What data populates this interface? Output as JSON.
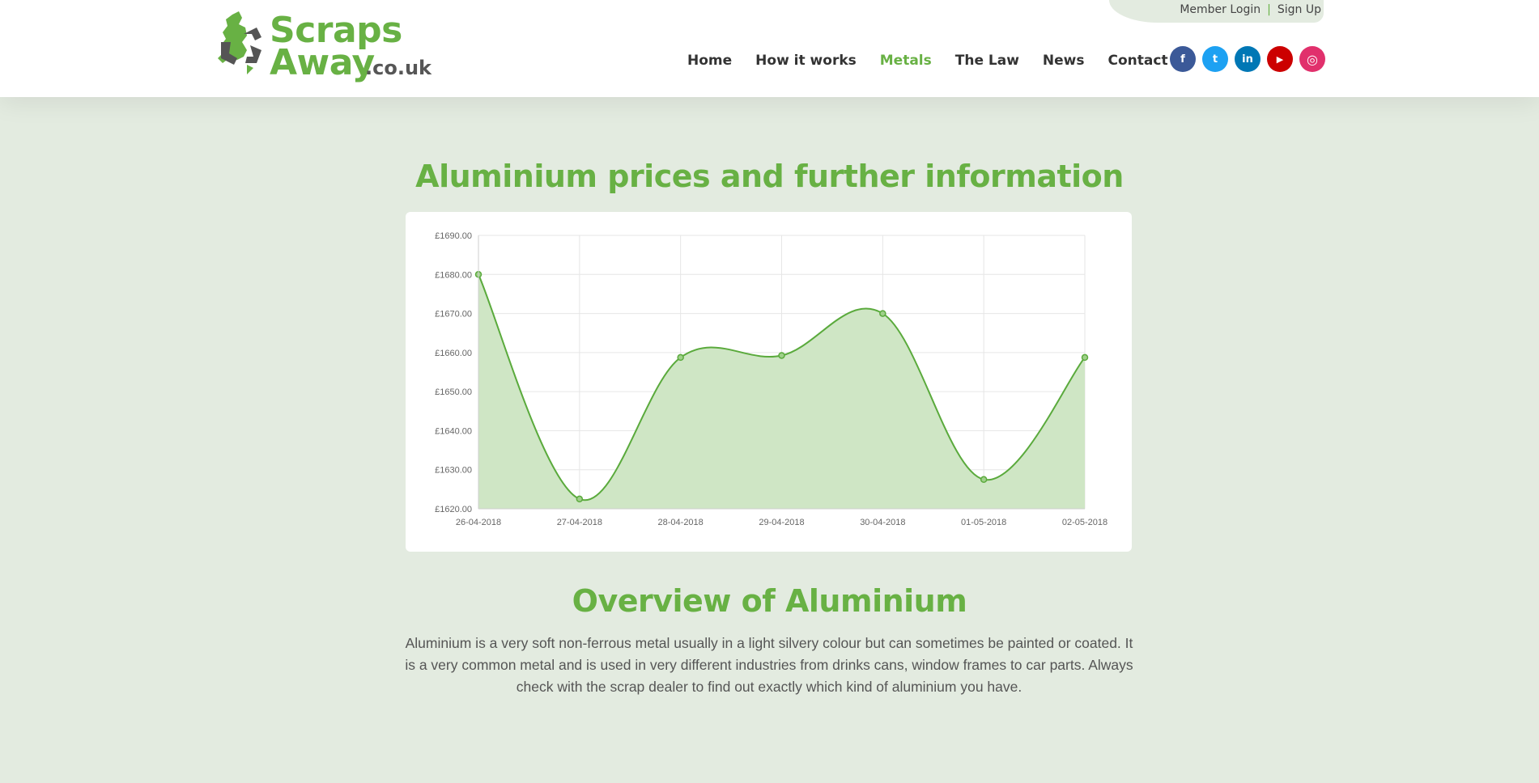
{
  "header": {
    "logo": {
      "line1": "Scraps",
      "line2": "Away",
      "suffix": ".co.uk"
    },
    "util_links": {
      "login": "Member Login",
      "separator": "|",
      "signup": "Sign Up"
    },
    "nav": [
      {
        "label": "Home",
        "active": false
      },
      {
        "label": "How it works",
        "active": false
      },
      {
        "label": "Metals",
        "active": true
      },
      {
        "label": "The Law",
        "active": false
      },
      {
        "label": "News",
        "active": false
      },
      {
        "label": "Contact",
        "active": false
      }
    ],
    "social": [
      {
        "icon": "facebook-icon",
        "glyph": "f",
        "color": "#3b5998"
      },
      {
        "icon": "twitter-icon",
        "glyph": "t",
        "color": "#1da1f2"
      },
      {
        "icon": "linkedin-icon",
        "glyph": "in",
        "color": "#0077b5"
      },
      {
        "icon": "youtube-icon",
        "glyph": "▶",
        "color": "#cc0000"
      },
      {
        "icon": "instagram-icon",
        "glyph": "◎",
        "color": "#e1306c"
      }
    ]
  },
  "main": {
    "title": "Aluminium prices and further information",
    "overview_title": "Overview of Aluminium",
    "overview_text": "Aluminium is a very soft non-ferrous metal usually in a light silvery colour but can sometimes be painted or coated. It is a very common metal and is used in very different industries from drinks cans, window frames to car parts. Always check with the scrap dealer to find out exactly which kind of aluminium you have.",
    "next_heading_partial": ""
  },
  "colors": {
    "brand_green": "#68b144",
    "page_bg": "#e3ebe0",
    "chart_fill": "#cfe6c5",
    "chart_line": "#5aaa3c"
  },
  "chart_data": {
    "type": "area",
    "x": [
      "26-04-2018",
      "27-04-2018",
      "28-04-2018",
      "29-04-2018",
      "30-04-2018",
      "01-05-2018",
      "02-05-2018"
    ],
    "series": [
      {
        "values": [
          1680.0,
          1622.5,
          1658.75,
          1659.25,
          1670.0,
          1627.5,
          1658.75
        ]
      }
    ],
    "y_ticks": [
      "£1620.00",
      "£1630.00",
      "£1640.00",
      "£1650.00",
      "£1660.00",
      "£1670.00",
      "£1680.00",
      "£1690.00"
    ],
    "ylim": [
      1620,
      1690
    ],
    "grid": true,
    "legend": "none"
  }
}
